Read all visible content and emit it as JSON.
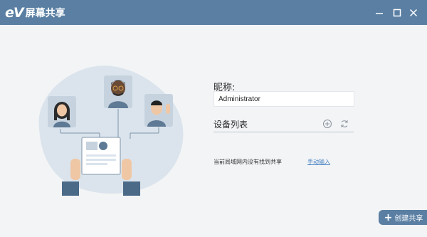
{
  "app": {
    "logo_text": "eV",
    "title": "屏幕共享"
  },
  "window_controls": {
    "minimize": "minimize-icon",
    "maximize": "maximize-icon",
    "close": "close-icon"
  },
  "form": {
    "nickname_label": "昵称:",
    "nickname_value": "Administrator"
  },
  "device_list": {
    "title": "设备列表",
    "add_icon": "add-circle-icon",
    "refresh_icon": "refresh-icon",
    "empty_message": "当前局域网内没有找到共享",
    "manual_input_label": "手动输入"
  },
  "create_share": {
    "label": "创建共享",
    "icon": "plus-icon"
  },
  "colors": {
    "titlebar": "#5a7fa3",
    "background": "#f3f4f6",
    "link": "#4a83c4",
    "illustration_blob": "#dbe4ec"
  }
}
